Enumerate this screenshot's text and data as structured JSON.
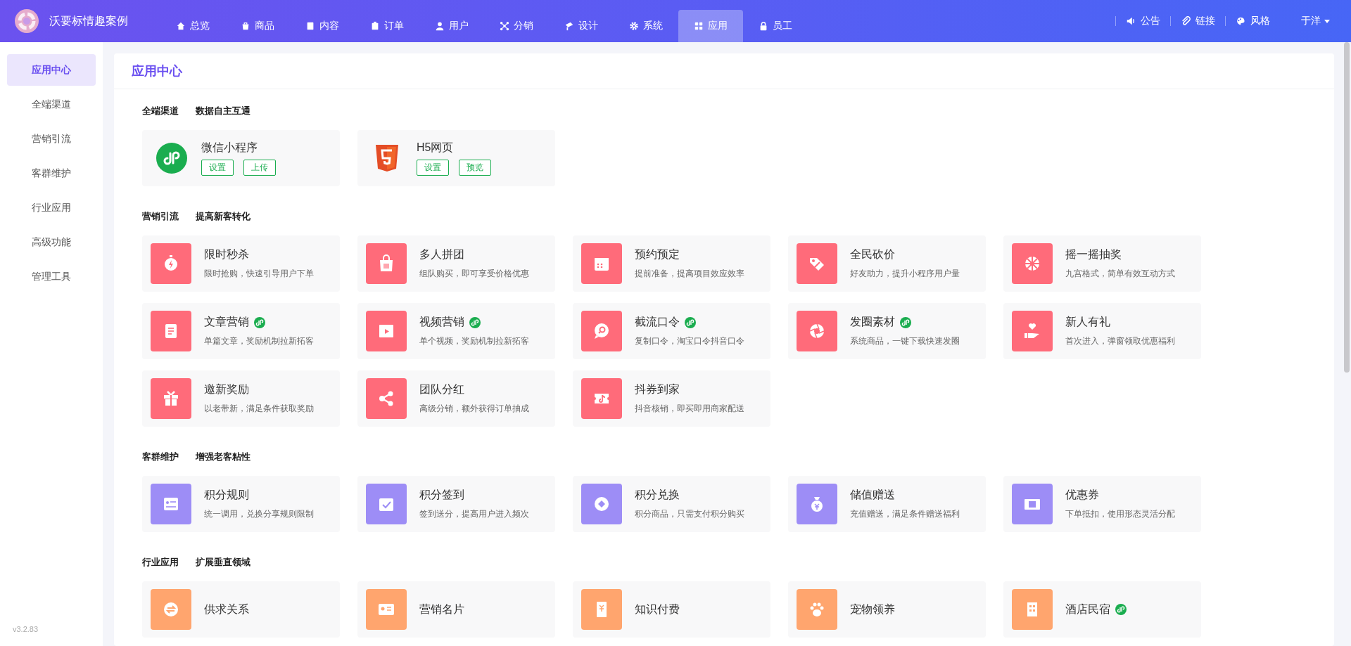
{
  "app": {
    "name": "沃要标情趣案例"
  },
  "nav": [
    {
      "label": "总览",
      "selected": false
    },
    {
      "label": "商品",
      "selected": false
    },
    {
      "label": "内容",
      "selected": false
    },
    {
      "label": "订单",
      "selected": false
    },
    {
      "label": "用户",
      "selected": false
    },
    {
      "label": "分销",
      "selected": false
    },
    {
      "label": "设计",
      "selected": false
    },
    {
      "label": "系统",
      "selected": false
    },
    {
      "label": "应用",
      "selected": true
    },
    {
      "label": "员工",
      "selected": false
    }
  ],
  "header_links": [
    "公告",
    "链接",
    "风格"
  ],
  "user": {
    "name": "于洋"
  },
  "sidebar": {
    "items": [
      {
        "label": "应用中心",
        "selected": true
      },
      {
        "label": "全端渠道",
        "selected": false
      },
      {
        "label": "营销引流",
        "selected": false
      },
      {
        "label": "客群维护",
        "selected": false
      },
      {
        "label": "行业应用",
        "selected": false
      },
      {
        "label": "高级功能",
        "selected": false
      },
      {
        "label": "管理工具",
        "selected": false
      }
    ],
    "version": "v3.2.83"
  },
  "page_title": "应用中心",
  "sections": [
    {
      "title": "全端渠道",
      "subtitle": "数据自主互通",
      "kind": "channel",
      "items": [
        {
          "title": "微信小程序",
          "buttons": [
            "设置",
            "上传"
          ]
        },
        {
          "title": "H5网页",
          "buttons": [
            "设置",
            "预览"
          ]
        }
      ]
    },
    {
      "title": "营销引流",
      "subtitle": "提高新客转化",
      "kind": "app",
      "color": "#ff6b7a",
      "items": [
        {
          "title": "限时秒杀",
          "description": "限时抢购，快速引导用户下单",
          "mini_program": false
        },
        {
          "title": "多人拼团",
          "description": "组队购买，即可享受价格优惠",
          "mini_program": false
        },
        {
          "title": "预约预定",
          "description": "提前准备，提高项目效应效率",
          "mini_program": false
        },
        {
          "title": "全民砍价",
          "description": "好友助力，提升小程序用户量",
          "mini_program": false
        },
        {
          "title": "摇一摇抽奖",
          "description": "九宫格式，简单有效互动方式",
          "mini_program": false
        },
        {
          "title": "文章营销",
          "description": "单篇文章，奖励机制拉新拓客",
          "mini_program": true
        },
        {
          "title": "视频营销",
          "description": "单个视频，奖励机制拉新拓客",
          "mini_program": true
        },
        {
          "title": "截流口令",
          "description": "复制口令，淘宝口令抖音口令",
          "mini_program": true
        },
        {
          "title": "发圈素材",
          "description": "系统商品，一键下载快速发圈",
          "mini_program": true
        },
        {
          "title": "新人有礼",
          "description": "首次进入，弹窗领取优惠福利",
          "mini_program": false
        },
        {
          "title": "邀新奖励",
          "description": "以老带新，满足条件获取奖励",
          "mini_program": false
        },
        {
          "title": "团队分红",
          "description": "高级分销，额外获得订单抽成",
          "mini_program": false
        },
        {
          "title": "抖券到家",
          "description": "抖音核销，即买即用商家配送",
          "mini_program": false
        }
      ]
    },
    {
      "title": "客群维护",
      "subtitle": "增强老客粘性",
      "kind": "app",
      "color": "#9d8df6",
      "items": [
        {
          "title": "积分规则",
          "description": "统一调用，兑换分享规则限制",
          "mini_program": false
        },
        {
          "title": "积分签到",
          "description": "签到送分，提高用户进入频次",
          "mini_program": false
        },
        {
          "title": "积分兑换",
          "description": "积分商品，只需支付积分购买",
          "mini_program": false
        },
        {
          "title": "储值赠送",
          "description": "充值赠送，满足条件赠送福利",
          "mini_program": false
        },
        {
          "title": "优惠券",
          "description": "下单抵扣，使用形态灵活分配",
          "mini_program": false
        }
      ]
    },
    {
      "title": "行业应用",
      "subtitle": "扩展垂直领域",
      "kind": "app",
      "color": "#ffa56e",
      "items": [
        {
          "title": "供求关系",
          "mini_program": false
        },
        {
          "title": "营销名片",
          "mini_program": false
        },
        {
          "title": "知识付费",
          "mini_program": false
        },
        {
          "title": "宠物领养",
          "mini_program": false
        },
        {
          "title": "酒店民宿",
          "mini_program": true
        }
      ]
    }
  ]
}
